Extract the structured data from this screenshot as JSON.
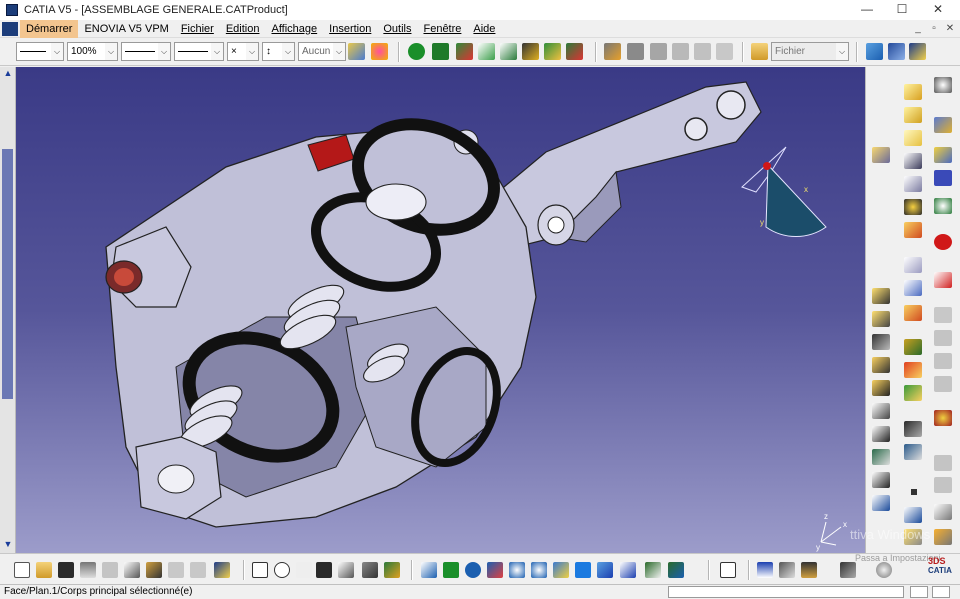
{
  "window": {
    "title": "CATIA V5 - [ASSEMBLAGE GENERALE.CATProduct]",
    "minimize": "—",
    "maximize": "☐",
    "close": "✕"
  },
  "menu": {
    "items": [
      "Démarrer",
      "ENOVIA V5 VPM",
      "Fichier",
      "Edition",
      "Affichage",
      "Insertion",
      "Outils",
      "Fenêtre",
      "Aide"
    ],
    "mdi_min": "_",
    "mdi_restore": "▫",
    "mdi_close": "✕"
  },
  "toolbar": {
    "line_weight_combo": "",
    "zoom_combo": "100%",
    "line_type_combo": "",
    "line_thickness_combo": "",
    "point_combo": "×",
    "layer_combo": "Aucun",
    "filter_combo": "Fichier"
  },
  "status": {
    "text": "Face/Plan.1/Corps principal sélectionné(e)"
  },
  "watermark": {
    "line1": "ttiva Windows",
    "line2": "Passa a Impostazioni"
  },
  "logo": {
    "brand": "3DS",
    "product": "CATIA"
  },
  "viewport": {
    "compass_axes": [
      "x",
      "y",
      "z"
    ]
  },
  "colors": {
    "viewport_top": "#3a3a86",
    "viewport_bottom": "#9c9cca",
    "part_body": "#c8c8de",
    "part_shadow": "#7f7fa3",
    "ring_black": "#111111",
    "plug_red": "#b41818",
    "menu_highlight": "#f3c58f"
  }
}
